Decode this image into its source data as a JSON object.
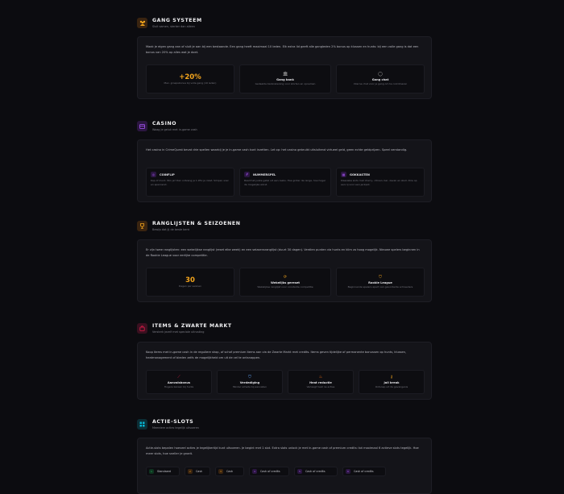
{
  "sections": [
    {
      "title": "GANG SYSTEEM",
      "subtitle": "Sluit samen, sterker dan alleen",
      "icon": "gang-icon",
      "color": "#f4a51c",
      "description": "Maak je eigen gang aan of sluit je aan bij een bestaande. Een gang heeft maximaal 10 leden. Elk extra lid geeft alle gangleden 2% bonus op klussen en hunts: bij een volle gang is dat een bonus van 20% op alles wat je doet.",
      "tiles": [
        {
          "icon": "",
          "value": "+20%",
          "title": "",
          "sub": "Max. groepsbonus bij volle gang (10 leden)"
        },
        {
          "icon": "bank-icon",
          "value": "",
          "title": "Gang bank",
          "sub": "Gedeelde bankrekening voor storten en opnemen"
        },
        {
          "icon": "chat-icon",
          "value": "",
          "title": "Gang chat",
          "sub": "Interne chat voor je gang om te coördineren"
        }
      ]
    },
    {
      "title": "CASINO",
      "subtitle": "Waag je geluk met in-game cash",
      "icon": "casino-icon",
      "color": "#a855f7",
      "description": "Het casino in CrimeQuest bevat drie spellen waarbij je je in-game cash kunt inzetten. Let op: het casino gebruikt uitsluitend virtueel geld, geen echte geldprijzen. Speel verstandig.",
      "tiles": [
        {
          "icon": "coin-icon",
          "title": "COINFLIP",
          "sub": "Kop of munt. Win je? Dan ontvang je 1.95x je inzet. Simpel, snel en spannend."
        },
        {
          "icon": "hash-icon",
          "title": "NUMMERSPEL",
          "sub": "Raad het juiste getal uit een reeks. Hoe groter de range, hoe hoger de mogelijke winst."
        },
        {
          "icon": "grid-icon",
          "title": "GOKKASTEN",
          "sub": "Klassieke slots met cherry, citroen, bar, zeven en skull. Drie op een rij voor een jackpot."
        }
      ]
    },
    {
      "title": "RANGLIJSTEN & SEIZOENEN",
      "subtitle": "Bewijs dat jij de beste bent",
      "icon": "trophy-icon",
      "color": "#f4a51c",
      "description": "Er zijn twee ranglijsten: een wekelijkse ranglijst (reset elke week) en een seizoensranglijst (duurt 30 dagen). Verdien punten via hunts en klim zo hoog mogelijk. Nieuwe spelers beginnen in de Rookie League voor eerlijke competitie.",
      "tiles": [
        {
          "icon": "",
          "value": "30",
          "title": "",
          "sub": "Dagen per seizoen"
        },
        {
          "icon": "refresh-icon",
          "value": "",
          "title": "Wekelijks gereset",
          "sub": "Wekelijkse ranglijst voor constante competitie"
        },
        {
          "icon": "shield-icon",
          "value": "",
          "title": "Rookie League",
          "sub": "Beginnende spelers apart van gevorderde schreeders"
        }
      ]
    },
    {
      "title": "ITEMS & ZWARTE MARKT",
      "subtitle": "Versterk jezelf met speciale uitrusting",
      "icon": "bag-icon",
      "color": "#e11d48",
      "description": "Koop items met in-game cash in de reguliere shop, of schaf premium items aan via de Zwarte Markt met credits. Items geven tijdelijke of permanente bonussen op hunts, klussen, heatmanagement of bieden zelfs de mogelijkheid om uit de cel te ontsnappen.",
      "tiles": [
        {
          "icon": "knife-icon",
          "title": "Aanvalsbonus",
          "sub": "Hogere kansen bij hunts"
        },
        {
          "icon": "shield-icon",
          "title": "Verdediging",
          "sub": "Minder schade bij aanvallen"
        },
        {
          "icon": "flame-icon",
          "title": "Heat reductie",
          "sub": "Verlaagt heat na acties"
        },
        {
          "icon": "key-icon",
          "title": "Jail break",
          "sub": "Ontsnap uit de gevangenis"
        }
      ]
    },
    {
      "title": "ACTIE-SLOTS",
      "subtitle": "Meerdere acties tegelijk uitvoeren",
      "icon": "slots-icon",
      "color": "#06b6d4",
      "description": "Actie-slots bepalen hoeveel acties je tegelijkertijd kunt uitvoeren. Je begint met 1 slot. Extra slots unlock je met in-game cash of premium credits: tot maximaal 6 actieve slots tegelijk. Hoe meer slots, hoe sneller je groeit.",
      "slots": [
        {
          "num": "1",
          "label": "Standaard",
          "color": "#22c55e"
        },
        {
          "num": "2",
          "label": "Cash",
          "color": "#f4a51c"
        },
        {
          "num": "3",
          "label": "Cash",
          "color": "#f4a51c"
        },
        {
          "num": "4",
          "label": "Cash of credits",
          "color": "#a855f7"
        },
        {
          "num": "5",
          "label": "Cash of credits",
          "color": "#a855f7"
        },
        {
          "num": "6",
          "label": "Cash of credits",
          "color": "#a855f7"
        }
      ]
    }
  ]
}
